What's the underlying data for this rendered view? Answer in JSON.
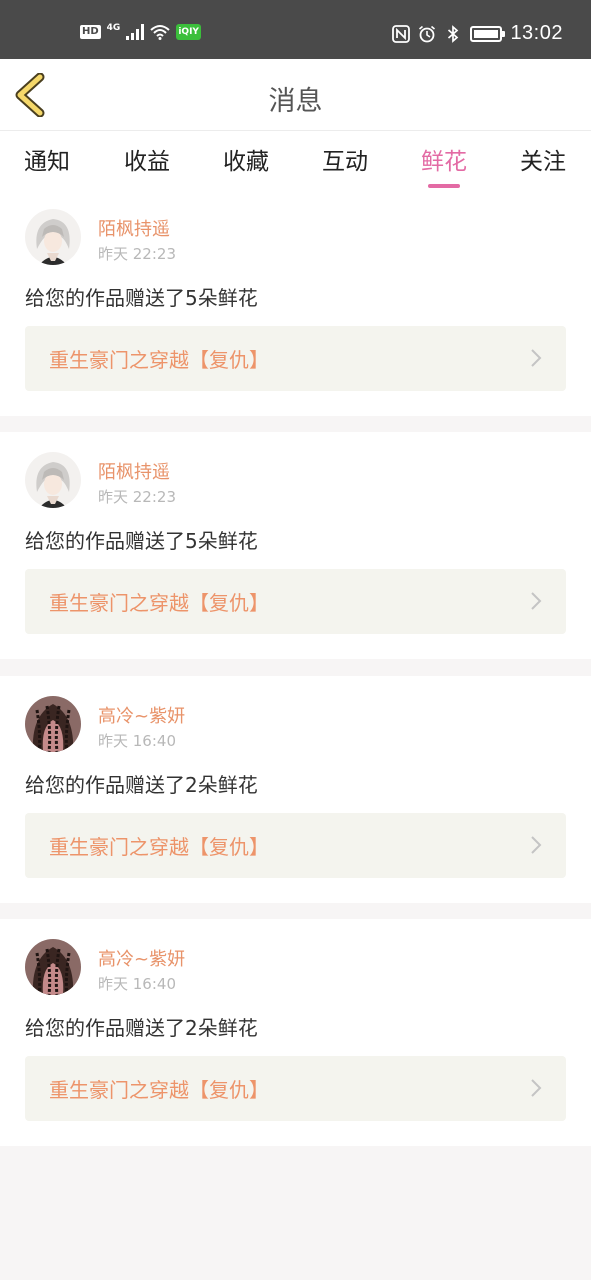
{
  "status_bar": {
    "hd": "HD",
    "network": "4G",
    "iqiyi": "iQIY",
    "time": "13:02",
    "icons": [
      "signal-icon",
      "wifi-icon",
      "nfc-icon",
      "alarm-icon",
      "bluetooth-icon",
      "battery-icon"
    ]
  },
  "header": {
    "title": "消息",
    "back_icon": "chevron-left-icon"
  },
  "tabs": [
    {
      "label": "通知",
      "active": false
    },
    {
      "label": "收益",
      "active": false
    },
    {
      "label": "收藏",
      "active": false
    },
    {
      "label": "互动",
      "active": false
    },
    {
      "label": "鲜花",
      "active": true
    },
    {
      "label": "关注",
      "active": false
    }
  ],
  "colors": {
    "accent_pink": "#e36aa4",
    "name_orange": "#e8936a",
    "work_title_orange": "#ed946a",
    "work_bg": "#f4f4ee",
    "status_bar_bg": "#4a4a4a"
  },
  "messages": [
    {
      "user": "陌枫持遥",
      "time": "昨天 22:23",
      "text": "给您的作品赠送了5朵鲜花",
      "work": "重生豪门之穿越【复仇】",
      "avatar": "avatar-white-hair"
    },
    {
      "user": "陌枫持遥",
      "time": "昨天 22:23",
      "text": "给您的作品赠送了5朵鲜花",
      "work": "重生豪门之穿越【复仇】",
      "avatar": "avatar-white-hair"
    },
    {
      "user": "高冷~紫妍",
      "time": "昨天 16:40",
      "text": "给您的作品赠送了2朵鲜花",
      "work": "重生豪门之穿越【复仇】",
      "avatar": "avatar-braids"
    },
    {
      "user": "高冷~紫妍",
      "time": "昨天 16:40",
      "text": "给您的作品赠送了2朵鲜花",
      "work": "重生豪门之穿越【复仇】",
      "avatar": "avatar-braids"
    }
  ]
}
